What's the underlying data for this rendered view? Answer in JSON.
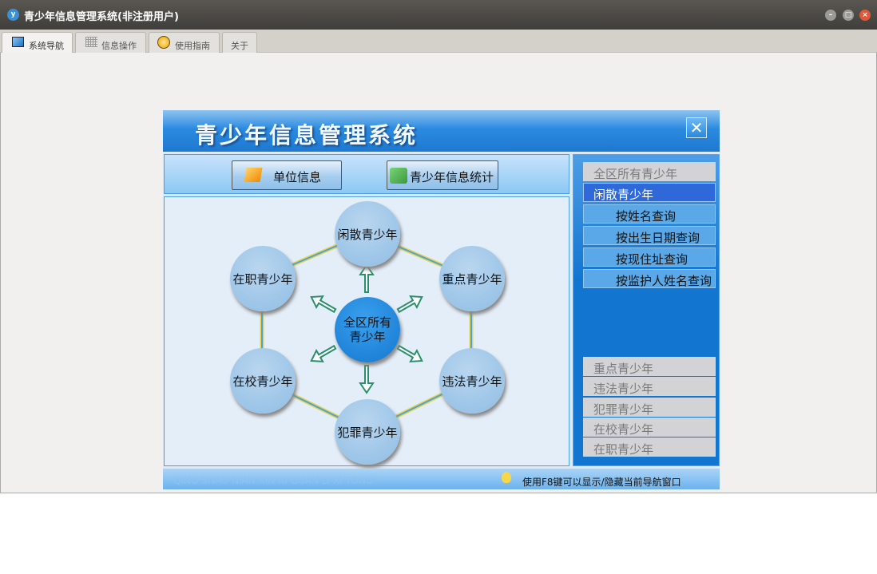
{
  "window": {
    "title": "青少年信息管理系统(非注册用户)"
  },
  "tabs": [
    {
      "label": "系统导航",
      "active": true
    },
    {
      "label": "信息操作"
    },
    {
      "label": "使用指南"
    },
    {
      "label": "关于"
    }
  ],
  "panel": {
    "title": "青少年信息管理系统",
    "toolbar": {
      "unit_info": "单位信息",
      "youth_stats": "青少年信息统计"
    },
    "diagram": {
      "center": [
        "全区所有",
        "青少年"
      ],
      "nodes": [
        "闲散青少年",
        "重点青少年",
        "违法青少年",
        "犯罪青少年",
        "在校青少年",
        "在职青少年"
      ]
    },
    "nav": {
      "top": "全区所有青少年",
      "selected": "闲散青少年",
      "sub": [
        "按姓名查询",
        "按出生日期查询",
        "按现住址查询",
        "按监护人姓名查询"
      ],
      "bottom": [
        "重点青少年",
        "违法青少年",
        "犯罪青少年",
        "在校青少年",
        "在职青少年"
      ]
    },
    "footer": {
      "pinyin": "QING SHAO NIAN XIN XI GUAN LI XI TONG",
      "tip": "使用F8键可以显示/隐藏当前导航窗口"
    }
  }
}
